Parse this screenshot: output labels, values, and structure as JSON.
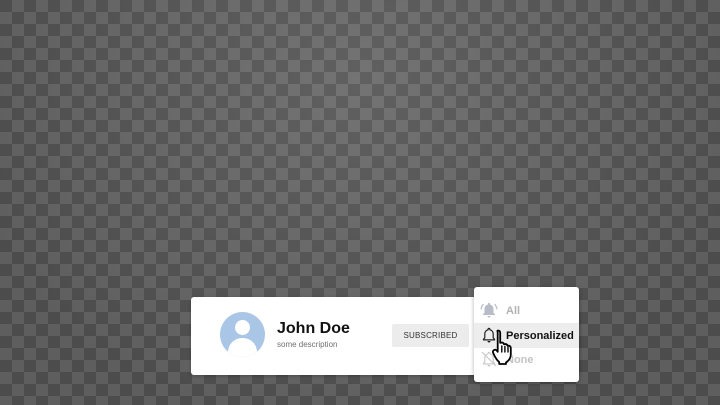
{
  "channel": {
    "name": "John Doe",
    "description": "some description",
    "avatar_icon": "user-avatar-icon",
    "avatar_color": "#a9c6e6"
  },
  "subscribe_button": {
    "label": "SUBSCRIBED"
  },
  "notification_menu": {
    "selected": "Personalized",
    "items": [
      {
        "label": "All",
        "icon": "bell-ringing-icon",
        "state": "dimmed"
      },
      {
        "label": "Personalized",
        "icon": "bell-outline-icon",
        "state": "hovered"
      },
      {
        "label": "None",
        "icon": "bell-off-icon",
        "state": "dimmed"
      }
    ]
  },
  "cursor": {
    "icon": "hand-pointer-icon"
  },
  "colors": {
    "card_background": "#ffffff",
    "button_background": "#ececec",
    "hover_background": "#ededed",
    "dimmed_text": "#b3b3b3"
  }
}
